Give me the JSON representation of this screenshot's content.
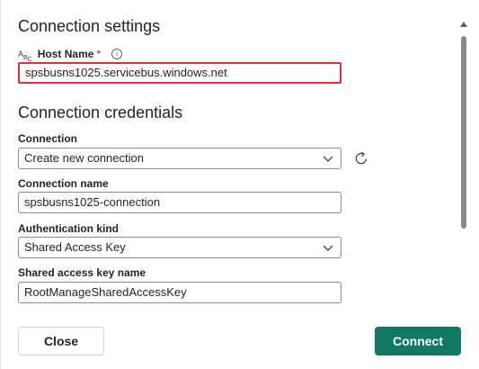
{
  "connection_settings": {
    "title": "Connection settings",
    "host_name": {
      "label": "Host Name",
      "required_marker": "*",
      "value": "spsbusns1025.servicebus.windows.net",
      "icon": "abc-text-icon",
      "info_icon": "info-icon"
    }
  },
  "connection_credentials": {
    "title": "Connection credentials",
    "connection": {
      "label": "Connection",
      "value": "Create new connection",
      "refresh_icon": "refresh-icon"
    },
    "connection_name": {
      "label": "Connection name",
      "value": "spsbusns1025-connection"
    },
    "authentication_kind": {
      "label": "Authentication kind",
      "value": "Shared Access Key"
    },
    "shared_access_key_name": {
      "label": "Shared access key name",
      "value": "RootManageSharedAccessKey"
    }
  },
  "footer": {
    "close_label": "Close",
    "connect_label": "Connect"
  },
  "colors": {
    "accent": "#117865",
    "highlight_border": "#d13438",
    "required": "#c50f1f"
  }
}
